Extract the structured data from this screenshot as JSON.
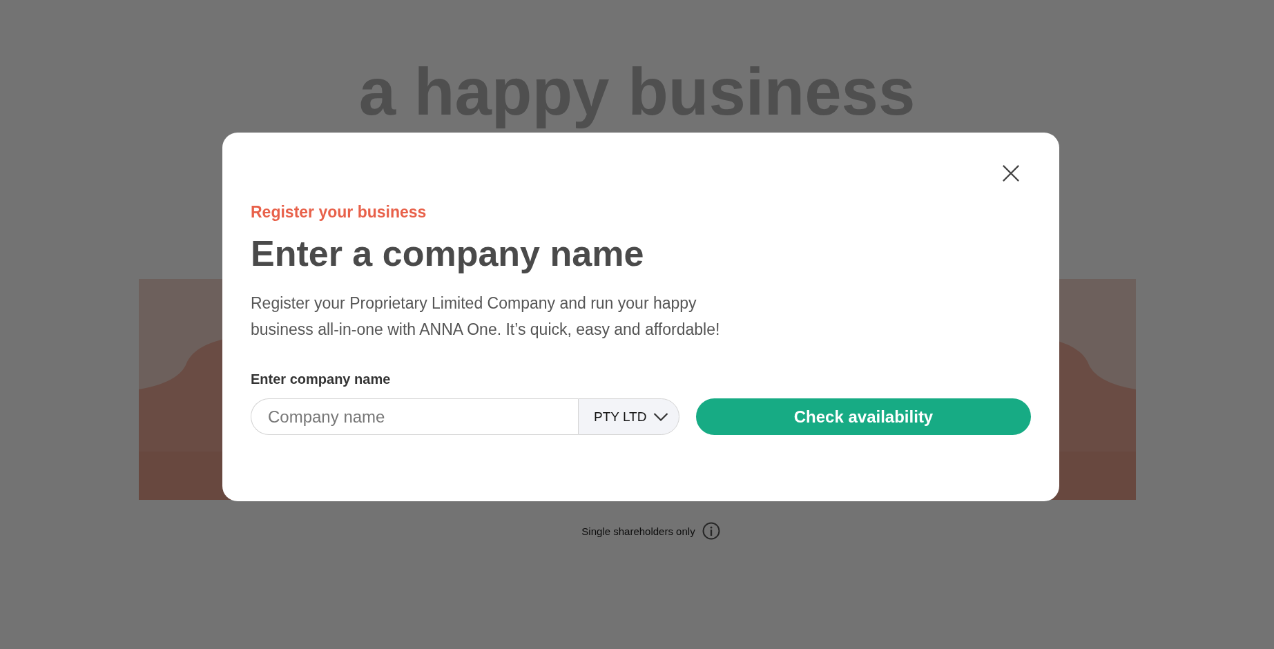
{
  "background": {
    "headline": "a happy business",
    "note": "Single shareholders only"
  },
  "modal": {
    "eyebrow": "Register your business",
    "title": "Enter a company name",
    "description": "Register your Proprietary Limited Company and run your happy business all-in-one with ANNA One. It’s quick, easy and affordable!",
    "field_label": "Enter company name",
    "company_field": {
      "placeholder": "Company name"
    },
    "company_type": "PTY LTD",
    "button": "Check availability"
  }
}
